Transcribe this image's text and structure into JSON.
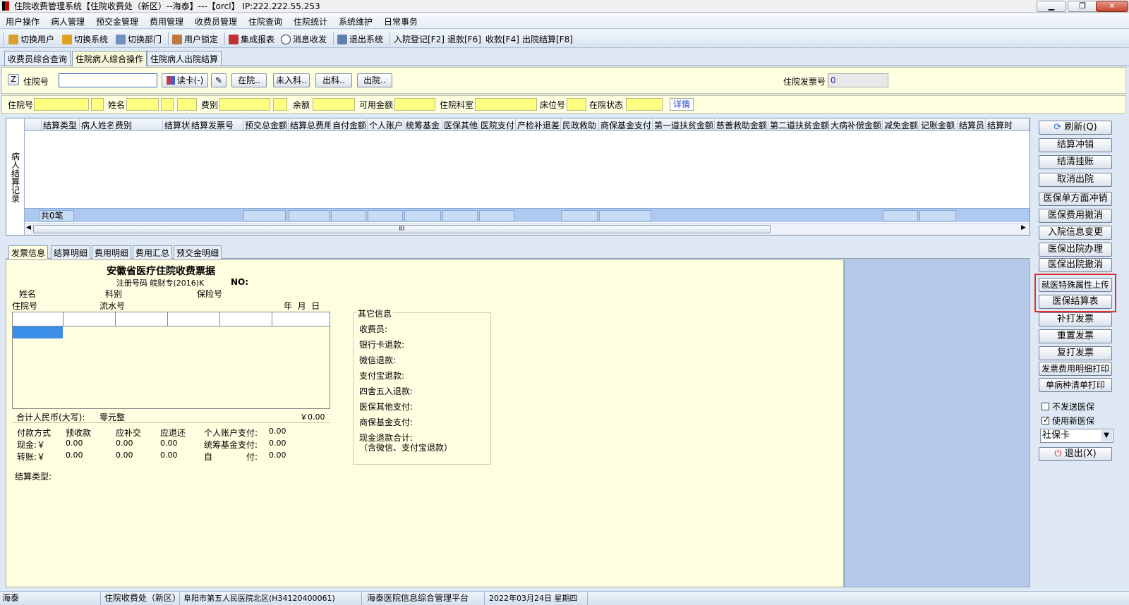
{
  "window": {
    "title": "住院收费管理系统【住院收费处（新区）--海泰】---【orcl】 IP:222.222.55.253"
  },
  "menu": [
    "用户操作",
    "病人管理",
    "预交金管理",
    "费用管理",
    "收费员管理",
    "住院查询",
    "住院统计",
    "系统维护",
    "日常事务"
  ],
  "toolbar": {
    "items": [
      "切换用户",
      "切换系统",
      "切换部门",
      "用户锁定",
      "集成报表",
      "消息收发",
      "退出系统",
      "入院登记[F2]",
      "退款[F6]",
      "收款[F4]",
      "出院结算[F8]"
    ]
  },
  "top_tabs": [
    "收费员综合查询",
    "住院病人综合操作",
    "住院病人出院结算"
  ],
  "query": {
    "z_label": "Z",
    "admission_label": "住院号",
    "admission_value": "",
    "read_card": "读卡(-)",
    "btn_inhosp": "在院..",
    "btn_notin": "未入科..",
    "btn_out": "出科..",
    "btn_discharge": "出院..",
    "invoice_label": "住院发票号",
    "invoice_value": "0"
  },
  "info_row": {
    "admission": "住院号",
    "name": "姓名",
    "fee_type": "费别",
    "balance": "余额",
    "available": "可用金额",
    "dept": "住院科室",
    "bed": "床位号",
    "status": "在院状态",
    "detail": "详情"
  },
  "grid": {
    "side_label": "病人结算记录",
    "columns": [
      "结算类型",
      "病人姓名",
      "费别",
      "结算状",
      "结算发票号",
      "预交总金额",
      "结算总费用",
      "自付金额",
      "个人账户",
      "统筹基金",
      "医保其他",
      "医院支付",
      "产检补退差",
      "民政救助",
      "商保基金支付",
      "第一道扶贫金额",
      "慈善救助金额",
      "第二道扶贫金额",
      "大病补偿金额",
      "减免金额",
      "记账金额",
      "结算员",
      "结算时"
    ],
    "footer_count": "共0笔",
    "scroll_mark": "III"
  },
  "right_buttons": [
    "刷新(Q)",
    "结算冲销",
    "结清挂账",
    "取消出院",
    "医保单方面冲销",
    "医保费用撤消",
    "入院信息变更",
    "医保出院办理",
    "医保出院撤消",
    "就医特殊属性上传",
    "医保结算表",
    "补打发票",
    "重置发票",
    "复打发票",
    "发票费用明细打印",
    "单病种清单打印"
  ],
  "options": {
    "no_send": "不发送医保",
    "use_new": "使用新医保",
    "card_type": "社保卡",
    "exit": "退出(X)"
  },
  "sub_tabs": [
    "发票信息",
    "结算明细",
    "费用明细",
    "费用汇总",
    "预交金明细"
  ],
  "invoice": {
    "title": "安徽省医疗住院收费票据",
    "reg_line": "注册号码 皖财专(2016)K",
    "no_label": "NO:",
    "name": "姓名",
    "dept": "科别",
    "ins_no": "保险号",
    "adm_no": "住院号",
    "serial": "流水号",
    "date": "年  月  日",
    "total_label": "合计人民币(大写):",
    "total_cn": "零元整",
    "total_num": "￥0.00",
    "pay_head": [
      "付款方式",
      "预收款",
      "应补交",
      "应退还",
      "个人账户支付:",
      "0.00"
    ],
    "cash_row": [
      "现金:￥",
      "0.00",
      "0.00",
      "0.00",
      "统筹基金支付:",
      "0.00"
    ],
    "transfer_row": [
      "转账:￥",
      "0.00",
      "0.00",
      "0.00",
      "自",
      "付:",
      "0.00"
    ],
    "settle_type": "结算类型:"
  },
  "other_info": {
    "legend": "其它信息",
    "lines": [
      "收费员:",
      "银行卡退款:",
      "微信退款:",
      "支付宝退款:",
      "四舍五入退款:",
      "医保其他支付:",
      "商保基金支付:",
      "现金退款合计:",
      "（含微信、支付宝退款）"
    ]
  },
  "status": {
    "user": "海泰",
    "dept": "住院收费处（新区）",
    "hospital": "阜阳市第五人民医院北区(H34120400061)",
    "platform": "海泰医院信息综合管理平台",
    "date": "2022年03月24日 星期四"
  }
}
